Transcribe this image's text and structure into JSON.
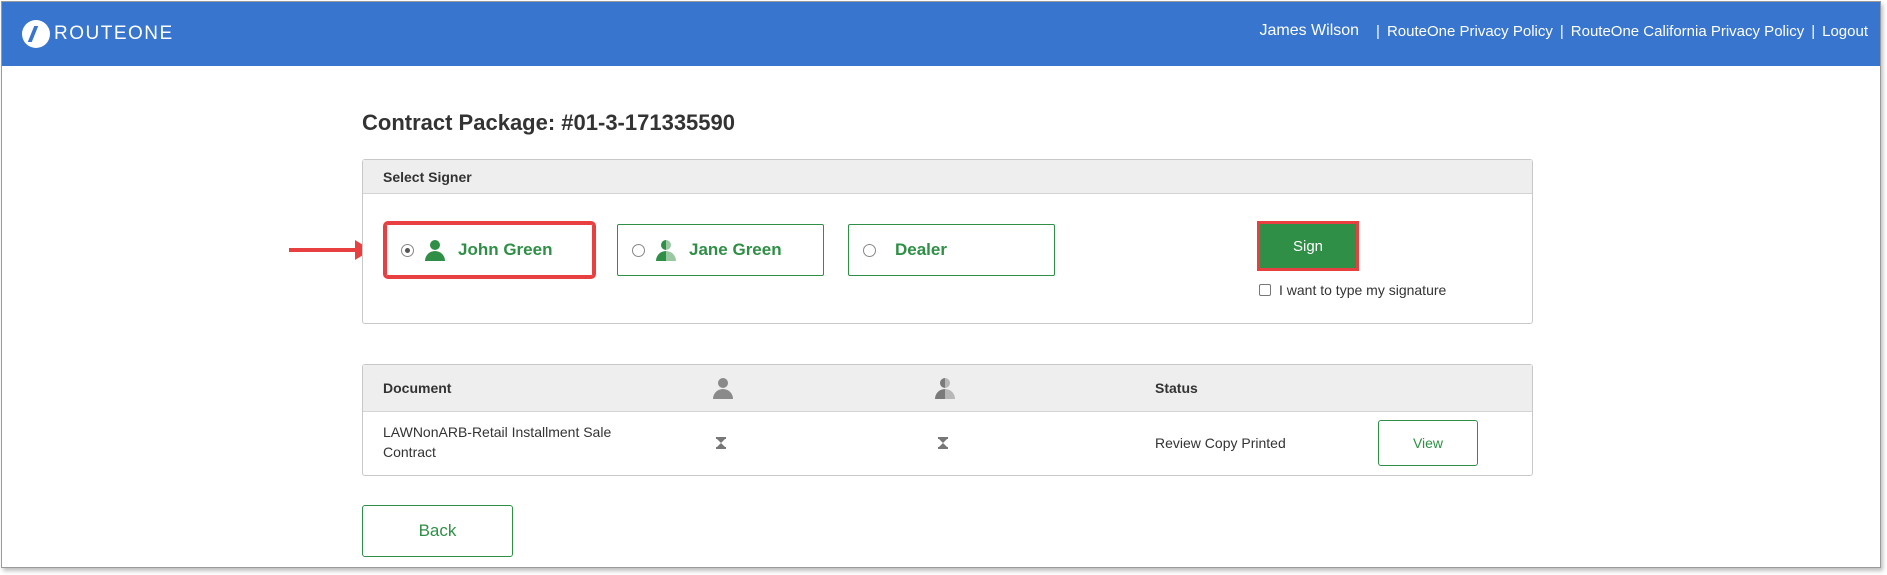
{
  "header": {
    "logo_text": "ROUTEONE",
    "user_name": "James Wilson",
    "separator": "|",
    "links": [
      "RouteOne Privacy Policy",
      "RouteOne California Privacy Policy",
      "Logout"
    ],
    "bar_color": "#3875cf"
  },
  "page": {
    "title": "Contract Package: #01-3-171335590"
  },
  "signer_panel": {
    "heading": "Select Signer",
    "signers": [
      {
        "name": "John Green",
        "selected": true,
        "icon": "person-icon"
      },
      {
        "name": "Jane Green",
        "selected": false,
        "icon": "co-buyer-person-icon"
      },
      {
        "name": "Dealer",
        "selected": false,
        "icon": null
      }
    ],
    "sign_label": "Sign",
    "type_signature_label": "I want to type my signature",
    "type_signature_checked": false
  },
  "documents": {
    "headers": {
      "document": "Document",
      "status": "Status"
    },
    "rows": [
      {
        "name": "LAWNonARB-Retail Installment Sale Contract",
        "status": "Review Copy Printed",
        "action": "View"
      }
    ]
  },
  "back_label": "Back",
  "colors": {
    "accent_green": "#2f8f46",
    "highlight_red": "#e84040"
  }
}
